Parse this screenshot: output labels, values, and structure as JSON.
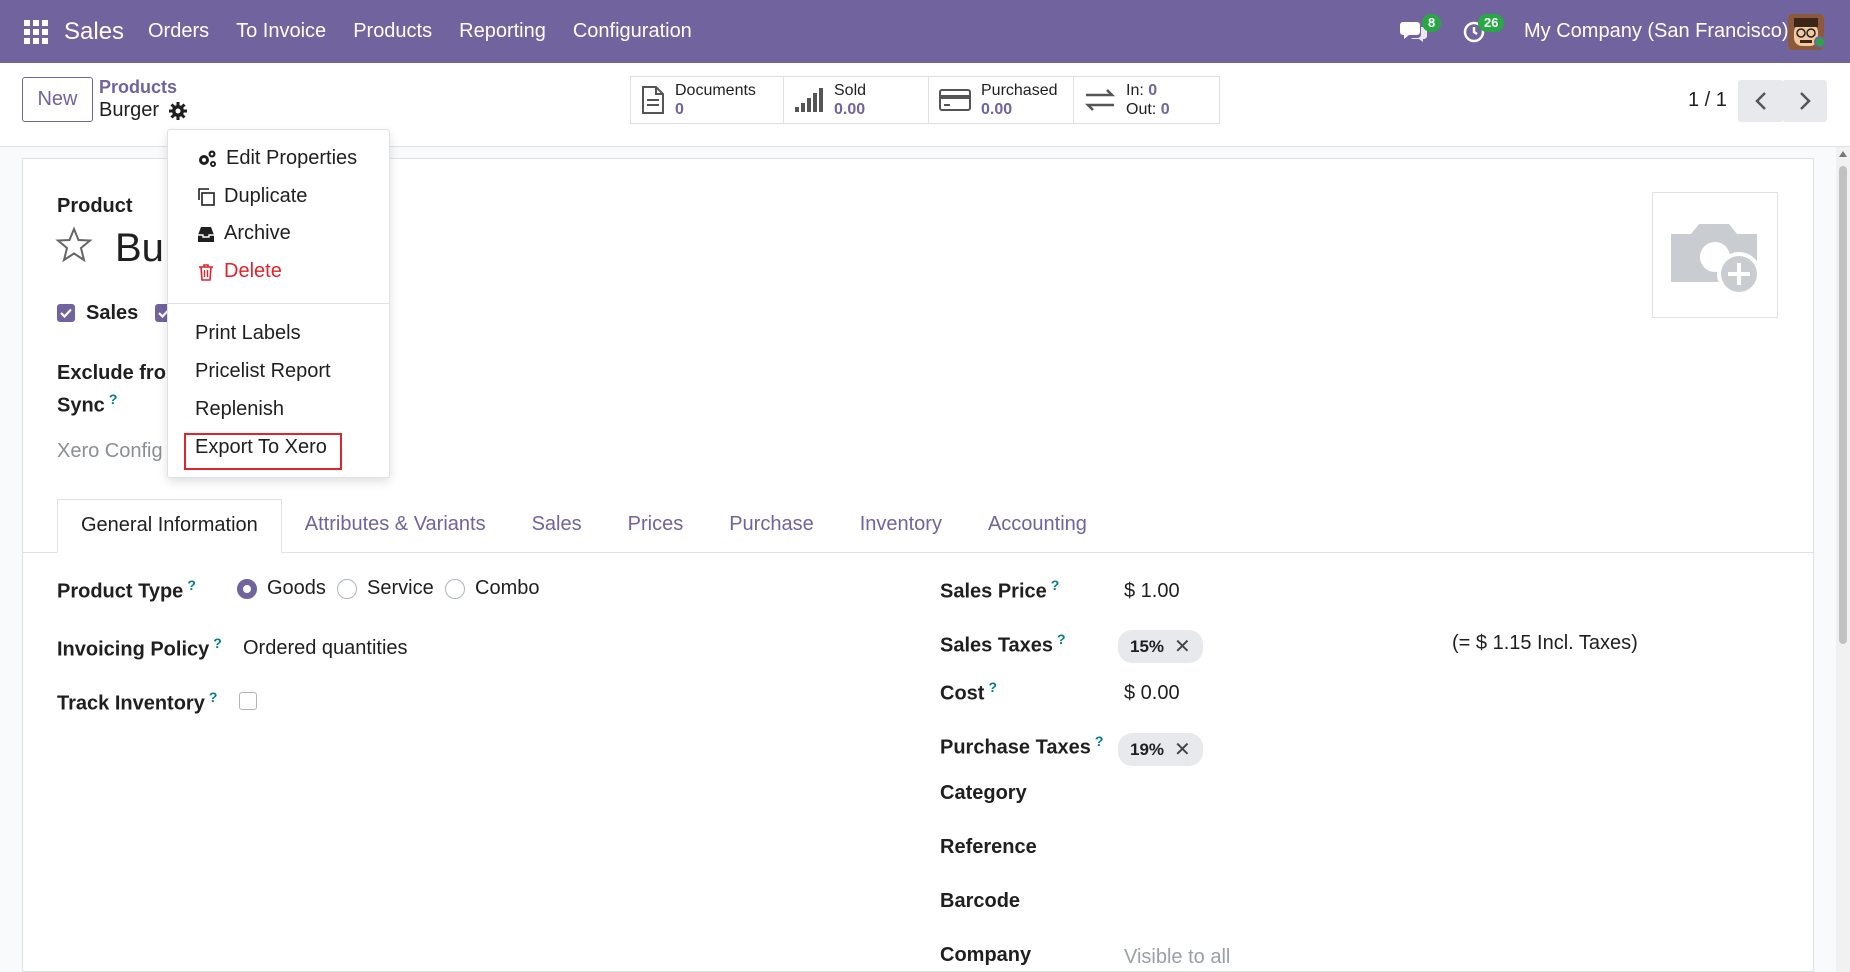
{
  "navbar": {
    "brand": "Sales",
    "menu": [
      "Orders",
      "To Invoice",
      "Products",
      "Reporting",
      "Configuration"
    ],
    "chat_badge": "8",
    "activity_badge": "26",
    "company": "My Company (San Francisco)"
  },
  "control": {
    "new_label": "New",
    "breadcrumb_parent": "Products",
    "breadcrumb_current": "Burger",
    "smart_buttons": {
      "documents": {
        "label": "Documents",
        "value": "0"
      },
      "sold": {
        "label": "Sold",
        "value": "0.00"
      },
      "purchased": {
        "label": "Purchased",
        "value": "0.00"
      },
      "in_label": "In:",
      "in_value": "0",
      "out_label": "Out:",
      "out_value": "0"
    },
    "pager": "1 / 1"
  },
  "dropdown": {
    "items": [
      "Edit Properties",
      "Duplicate",
      "Archive",
      "Delete",
      "Print Labels",
      "Pricelist Report",
      "Replenish",
      "Export To Xero"
    ]
  },
  "form": {
    "product_label": "Product",
    "product_name_partial": "Bu",
    "sales_checkbox": "Sales",
    "exclude_label_1": "Exclude fror",
    "exclude_label_2": "Sync",
    "xero_config": "Xero Config",
    "tabs": [
      "General Information",
      "Attributes & Variants",
      "Sales",
      "Prices",
      "Purchase",
      "Inventory",
      "Accounting"
    ],
    "product_type_label": "Product Type",
    "product_type_options": [
      "Goods",
      "Service",
      "Combo"
    ],
    "invoicing_policy_label": "Invoicing Policy",
    "invoicing_policy_value": "Ordered quantities",
    "track_inventory_label": "Track Inventory",
    "sales_price_label": "Sales Price",
    "sales_price_value": "$ 1.00",
    "sales_taxes_label": "Sales Taxes",
    "sales_tax_tag": "15%",
    "incl_taxes": "(= $ 1.15 Incl. Taxes)",
    "cost_label": "Cost",
    "cost_value": "$ 0.00",
    "purchase_taxes_label": "Purchase Taxes",
    "purchase_tax_tag": "19%",
    "category_label": "Category",
    "reference_label": "Reference",
    "barcode_label": "Barcode",
    "company_label": "Company",
    "company_placeholder": "Visible to all"
  },
  "colors": {
    "primary": "#71639e",
    "danger": "#e0242c",
    "help": "#017e84"
  }
}
